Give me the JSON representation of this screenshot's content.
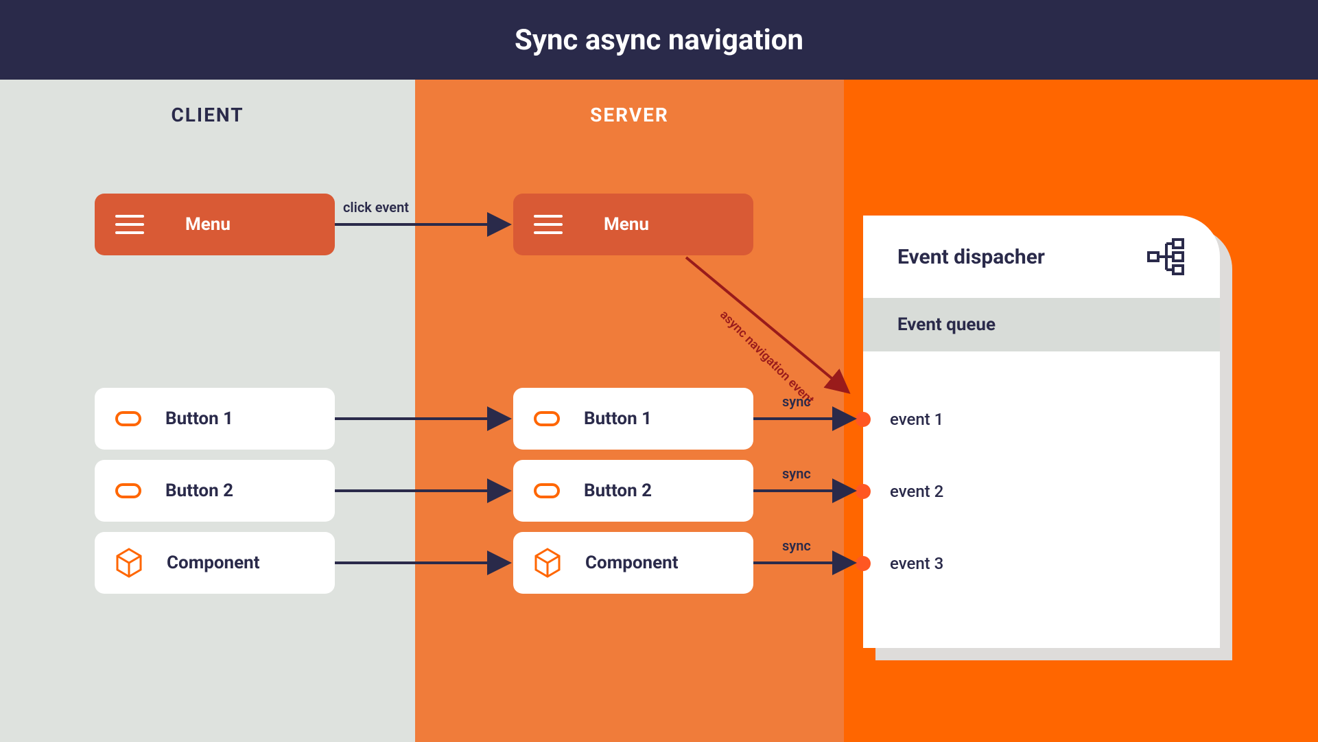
{
  "header": {
    "title": "Sync async navigation"
  },
  "panels": {
    "client_label": "CLIENT",
    "server_label": "SERVER"
  },
  "menu": {
    "label": "Menu"
  },
  "client_items": {
    "button1": "Button 1",
    "button2": "Button 2",
    "component": "Component"
  },
  "server_items": {
    "button1": "Button 1",
    "button2": "Button 2",
    "component": "Component"
  },
  "arrows": {
    "click_label": "click event",
    "async_label": "async navigation event",
    "sync_label_1": "sync",
    "sync_label_2": "sync",
    "sync_label_3": "sync"
  },
  "dispatcher": {
    "title": "Event dispacher",
    "queue_title": "Event queue",
    "events": {
      "e1": "event 1",
      "e2": "event 2",
      "e3": "event 3"
    }
  },
  "colors": {
    "header_bg": "#2a2a4a",
    "client_bg": "#dee2de",
    "server_bg": "#f07c3a",
    "right_bg": "#ff6600",
    "menu_bg": "#d95a35",
    "accent": "#ff6600",
    "dot": "#ff5722",
    "arrow": "#2a2a4a",
    "async_arrow": "#991b1b"
  }
}
